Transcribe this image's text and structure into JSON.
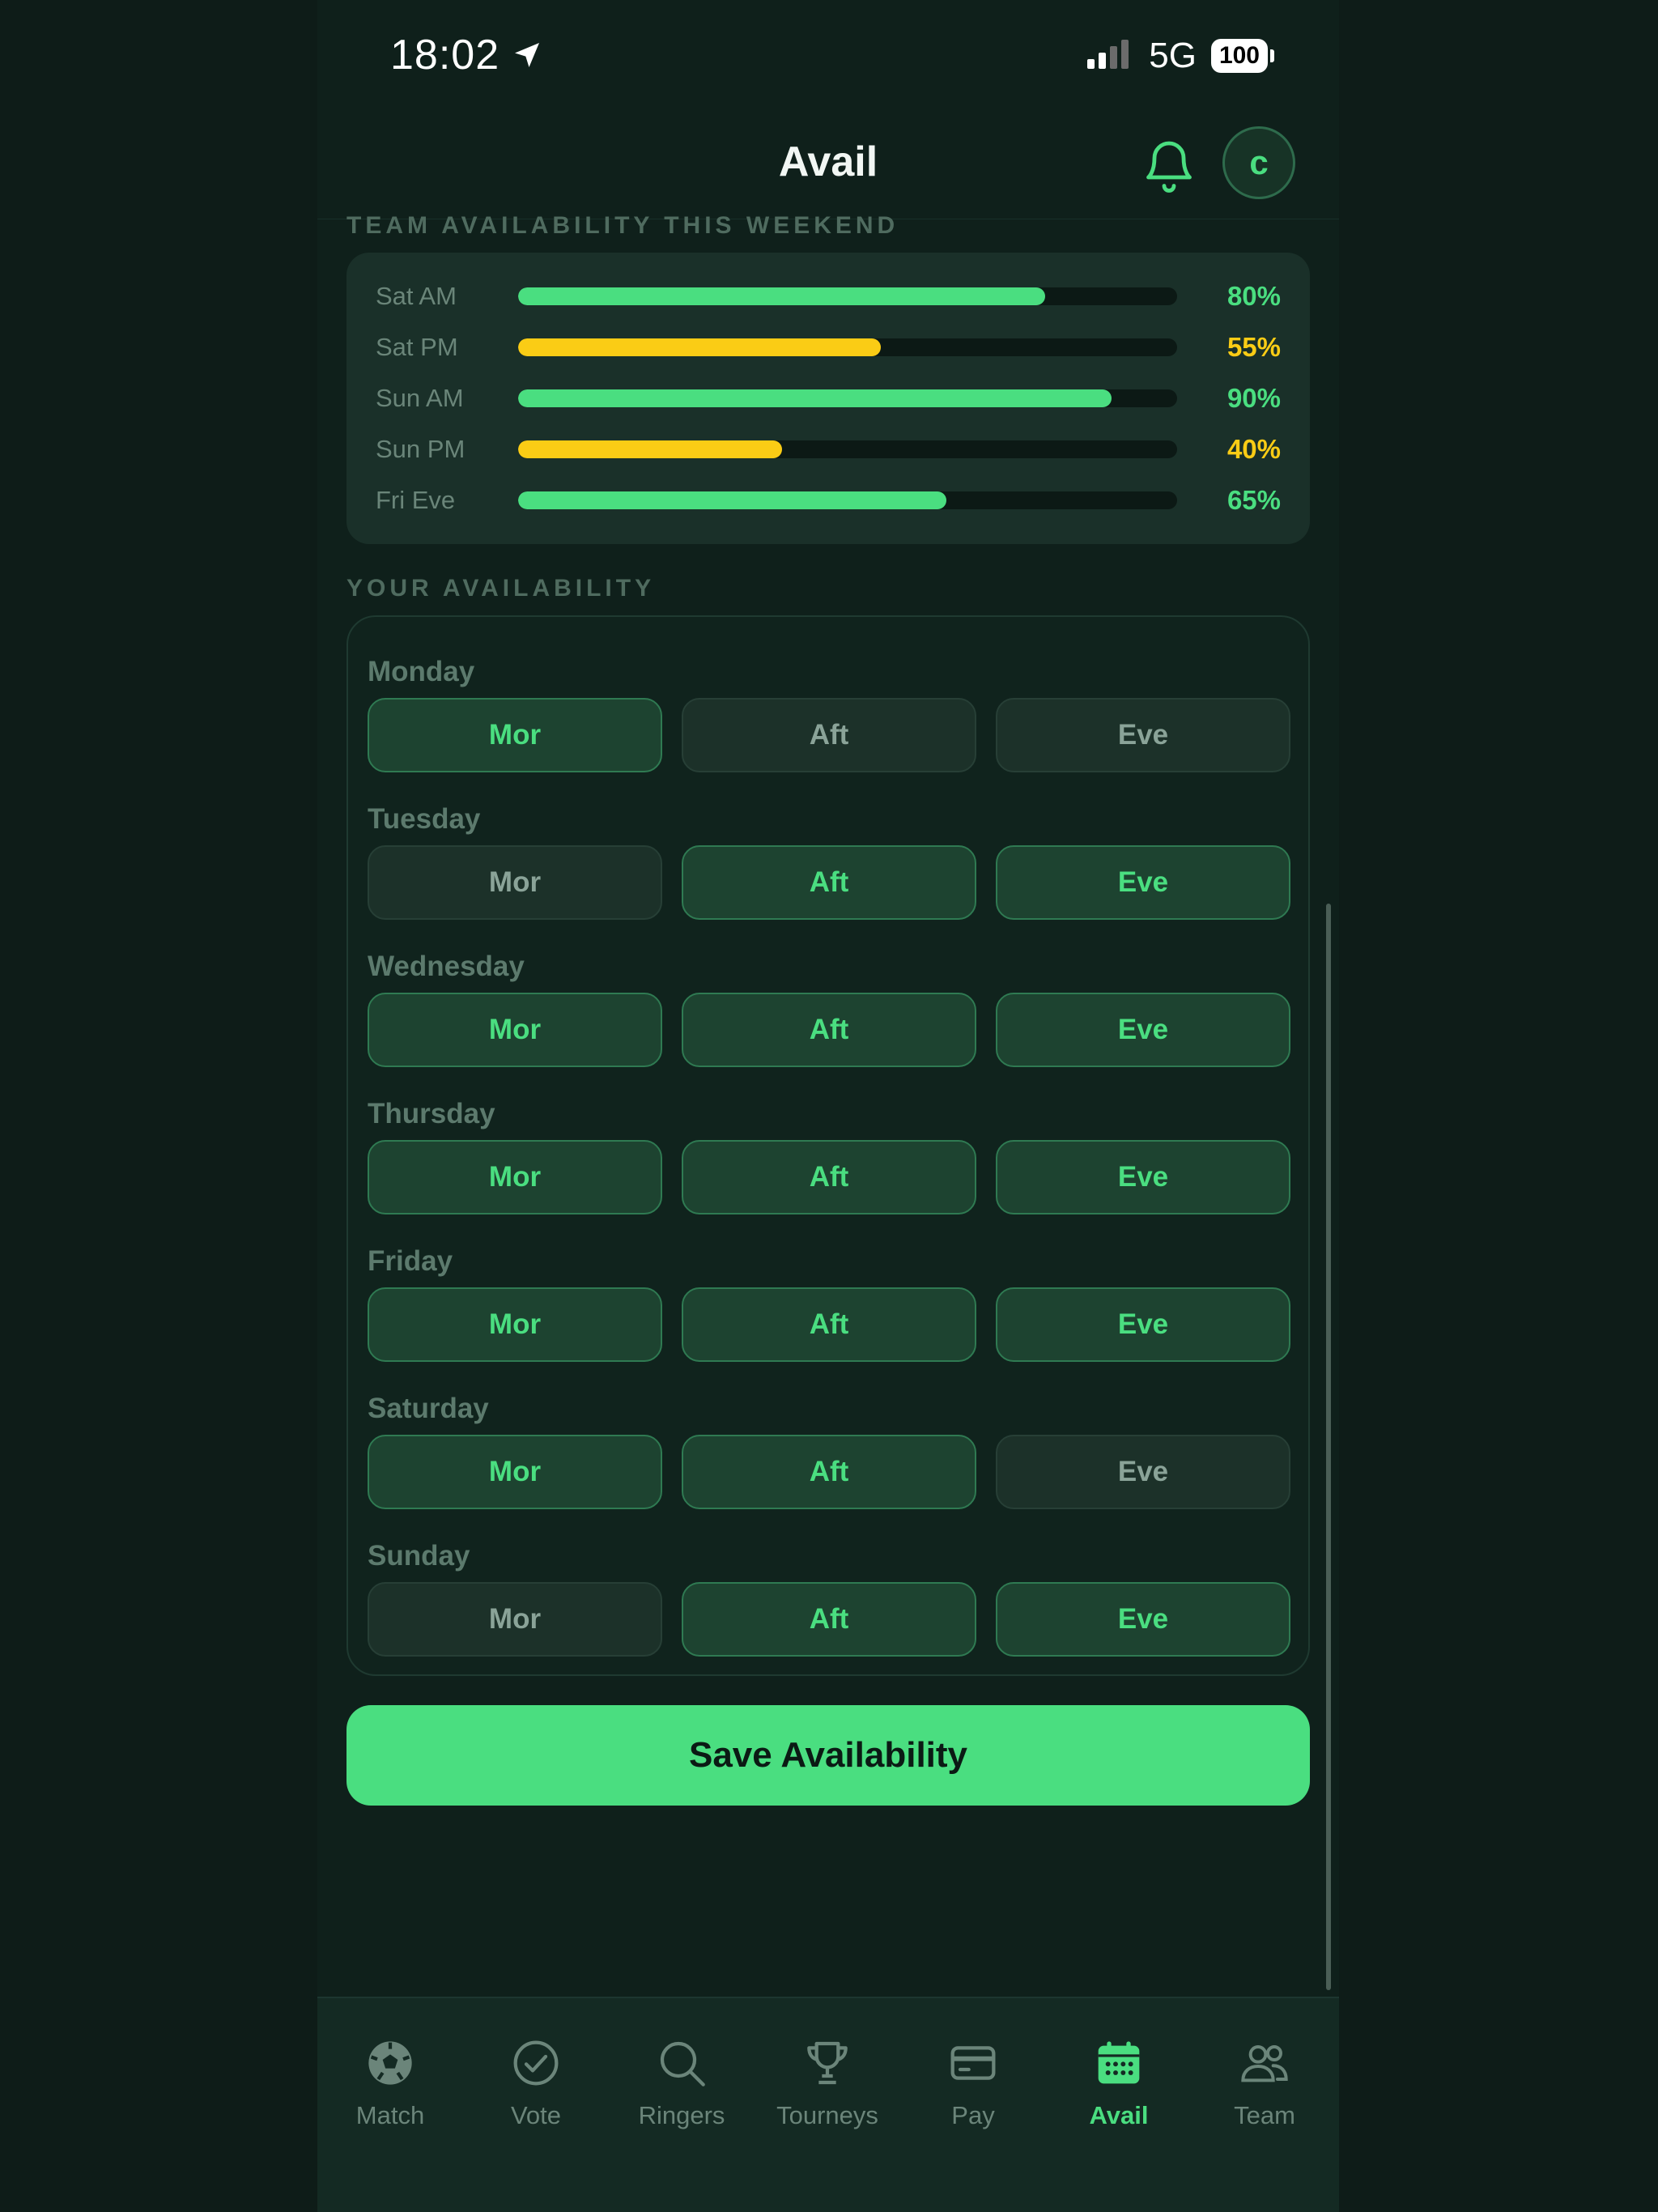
{
  "status_bar": {
    "time": "18:02",
    "network": "5G",
    "battery": "100"
  },
  "header": {
    "title": "Avail",
    "avatar_initial": "c"
  },
  "team_section": {
    "label": "TEAM AVAILABILITY THIS WEEKEND",
    "rows": [
      {
        "label": "Sat AM",
        "pct_text": "80%",
        "value": 0.8,
        "color": "#4ade80"
      },
      {
        "label": "Sat PM",
        "pct_text": "55%",
        "value": 0.55,
        "color": "#facc15"
      },
      {
        "label": "Sun AM",
        "pct_text": "90%",
        "value": 0.9,
        "color": "#4ade80"
      },
      {
        "label": "Sun PM",
        "pct_text": "40%",
        "value": 0.4,
        "color": "#facc15"
      },
      {
        "label": "Fri Eve",
        "pct_text": "65%",
        "value": 0.65,
        "color": "#4ade80"
      }
    ]
  },
  "your_section": {
    "label": "YOUR AVAILABILITY",
    "days": [
      {
        "name": "Monday",
        "slots": [
          {
            "label": "Mor",
            "on": true
          },
          {
            "label": "Aft",
            "on": false
          },
          {
            "label": "Eve",
            "on": false
          }
        ]
      },
      {
        "name": "Tuesday",
        "slots": [
          {
            "label": "Mor",
            "on": false
          },
          {
            "label": "Aft",
            "on": true
          },
          {
            "label": "Eve",
            "on": true
          }
        ]
      },
      {
        "name": "Wednesday",
        "slots": [
          {
            "label": "Mor",
            "on": true
          },
          {
            "label": "Aft",
            "on": true
          },
          {
            "label": "Eve",
            "on": true
          }
        ]
      },
      {
        "name": "Thursday",
        "slots": [
          {
            "label": "Mor",
            "on": true
          },
          {
            "label": "Aft",
            "on": true
          },
          {
            "label": "Eve",
            "on": true
          }
        ]
      },
      {
        "name": "Friday",
        "slots": [
          {
            "label": "Mor",
            "on": true
          },
          {
            "label": "Aft",
            "on": true
          },
          {
            "label": "Eve",
            "on": true
          }
        ]
      },
      {
        "name": "Saturday",
        "slots": [
          {
            "label": "Mor",
            "on": true
          },
          {
            "label": "Aft",
            "on": true
          },
          {
            "label": "Eve",
            "on": false
          }
        ]
      },
      {
        "name": "Sunday",
        "slots": [
          {
            "label": "Mor",
            "on": false
          },
          {
            "label": "Aft",
            "on": true
          },
          {
            "label": "Eve",
            "on": true
          }
        ]
      }
    ]
  },
  "save_label": "Save Availability",
  "tabs": [
    {
      "label": "Match",
      "icon": "soccer-ball-icon",
      "active": false
    },
    {
      "label": "Vote",
      "icon": "check-circle-icon",
      "active": false
    },
    {
      "label": "Ringers",
      "icon": "search-icon",
      "active": false
    },
    {
      "label": "Tourneys",
      "icon": "trophy-icon",
      "active": false
    },
    {
      "label": "Pay",
      "icon": "credit-card-icon",
      "active": false
    },
    {
      "label": "Avail",
      "icon": "calendar-icon",
      "active": true
    },
    {
      "label": "Team",
      "icon": "people-icon",
      "active": false
    }
  ],
  "colors": {
    "accent": "#4ade80",
    "warning": "#facc15",
    "background": "#0f201b"
  }
}
